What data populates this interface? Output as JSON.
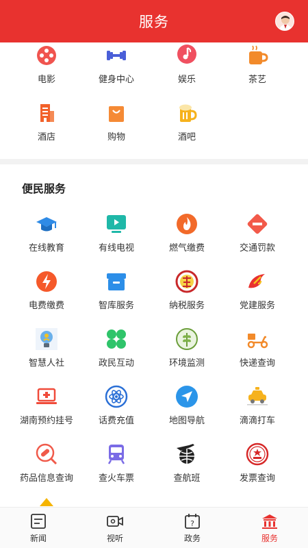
{
  "header": {
    "title": "服务"
  },
  "section1": {
    "items": [
      {
        "label": "电影",
        "icon": "film-reel-icon"
      },
      {
        "label": "健身中心",
        "icon": "dumbbell-icon"
      },
      {
        "label": "娱乐",
        "icon": "music-note-icon"
      },
      {
        "label": "茶艺",
        "icon": "tea-cup-icon"
      },
      {
        "label": "酒店",
        "icon": "hotel-building-icon"
      },
      {
        "label": "购物",
        "icon": "shopping-bag-icon"
      },
      {
        "label": "酒吧",
        "icon": "beer-mug-icon"
      }
    ]
  },
  "section2": {
    "title": "便民服务",
    "items": [
      {
        "label": "在线教育",
        "icon": "graduation-cap-icon"
      },
      {
        "label": "有线电视",
        "icon": "tv-play-icon"
      },
      {
        "label": "燃气缴费",
        "icon": "flame-icon"
      },
      {
        "label": "交通罚款",
        "icon": "no-entry-icon"
      },
      {
        "label": "电费缴费",
        "icon": "lightning-icon"
      },
      {
        "label": "智库服务",
        "icon": "archive-box-icon"
      },
      {
        "label": "纳税服务",
        "icon": "tax-emblem-icon"
      },
      {
        "label": "党建服务",
        "icon": "party-emblem-icon"
      },
      {
        "label": "智慧人社",
        "icon": "lightbulb-person-icon"
      },
      {
        "label": "政民互动",
        "icon": "clover-icon"
      },
      {
        "label": "环境监测",
        "icon": "wheat-badge-icon"
      },
      {
        "label": "快递查询",
        "icon": "delivery-scooter-icon"
      },
      {
        "label": "湖南预约挂号",
        "icon": "medical-laptop-icon"
      },
      {
        "label": "话费充值",
        "icon": "atom-icon"
      },
      {
        "label": "地图导航",
        "icon": "navigation-arrow-icon"
      },
      {
        "label": "滴滴打车",
        "icon": "taxi-car-icon"
      },
      {
        "label": "药品信息查询",
        "icon": "pill-search-icon"
      },
      {
        "label": "查火车票",
        "icon": "train-icon"
      },
      {
        "label": "查航班",
        "icon": "airplane-globe-icon"
      },
      {
        "label": "发票查询",
        "icon": "invoice-seal-icon"
      }
    ]
  },
  "tabbar": {
    "tabs": [
      {
        "label": "新闻",
        "icon": "news-icon"
      },
      {
        "label": "视听",
        "icon": "video-camera-icon"
      },
      {
        "label": "政务",
        "icon": "calendar-question-icon"
      },
      {
        "label": "服务",
        "icon": "service-building-icon"
      }
    ],
    "active_index": 3
  },
  "colors": {
    "brand": "#e8322f",
    "active_tab": "#e8322f"
  }
}
